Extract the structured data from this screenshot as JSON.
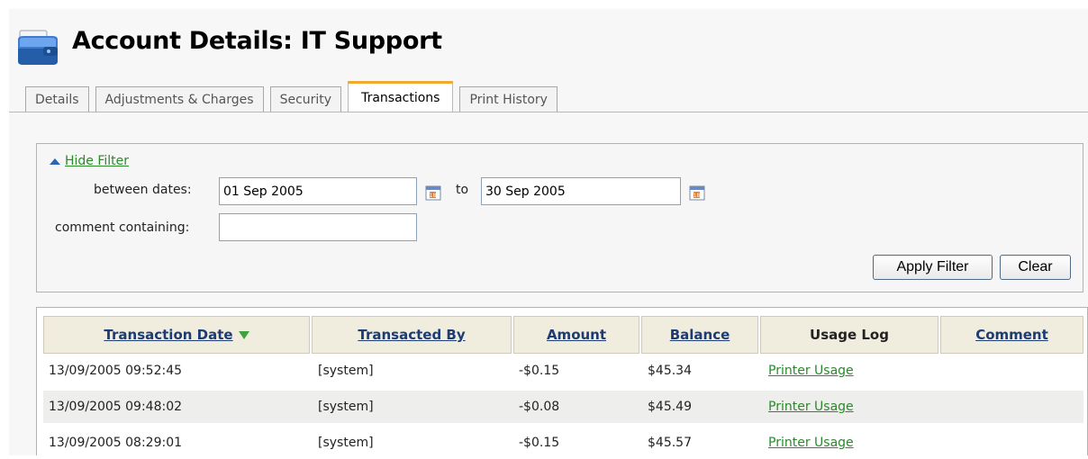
{
  "header": {
    "title": "Account Details: IT Support",
    "icon": "account-wallet-icon"
  },
  "tabs": [
    {
      "label": "Details",
      "active": false
    },
    {
      "label": "Adjustments & Charges",
      "active": false
    },
    {
      "label": "Security",
      "active": false
    },
    {
      "label": "Transactions",
      "active": true
    },
    {
      "label": "Print History",
      "active": false
    }
  ],
  "filter": {
    "toggle_label": "Hide Filter",
    "between_label": "between dates:",
    "from_value": "01 Sep 2005",
    "to_label": "to",
    "to_value": "30 Sep 2005",
    "comment_label": "comment containing:",
    "comment_value": "",
    "apply_label": "Apply Filter",
    "clear_label": "Clear"
  },
  "table": {
    "columns": [
      "Transaction Date",
      "Transacted By",
      "Amount",
      "Balance",
      "Usage Log",
      "Comment"
    ],
    "rows": [
      {
        "date": "13/09/2005 09:52:45",
        "by": "[system]",
        "amount": "-$0.15",
        "balance": "$45.34",
        "log": "Printer Usage",
        "comment": ""
      },
      {
        "date": "13/09/2005 09:48:02",
        "by": "[system]",
        "amount": "-$0.08",
        "balance": "$45.49",
        "log": "Printer Usage",
        "comment": ""
      },
      {
        "date": "13/09/2005 08:29:01",
        "by": "[system]",
        "amount": "-$0.15",
        "balance": "$45.57",
        "log": "Printer Usage",
        "comment": ""
      }
    ]
  },
  "colors": {
    "link": "#2a8a2a",
    "header_text": "#1c3c73",
    "active_tab_accent": "#f2a930",
    "sort_arrow": "#3ea33e"
  }
}
